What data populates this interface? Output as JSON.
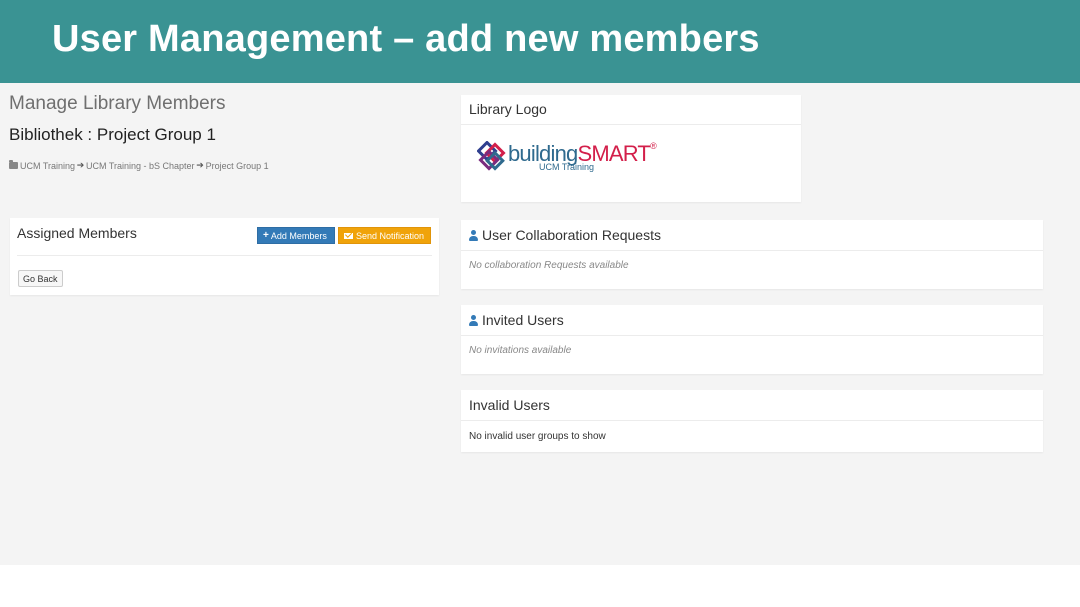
{
  "slide": {
    "title": "User Management – add new members",
    "banner_color": "#3a9393"
  },
  "page": {
    "title": "Manage Library Members",
    "subtitle": "Bibliothek : Project Group 1"
  },
  "breadcrumb": {
    "icon": "folder-icon",
    "items": [
      "UCM Training",
      "UCM Training - bS Chapter",
      "Project Group 1"
    ]
  },
  "assigned_members": {
    "title": "Assigned Members",
    "add_button": "Add Members",
    "add_button_color": "#337ab7",
    "notify_button": "Send Notification",
    "notify_button_color": "#f0a30a",
    "back_button": "Go Back"
  },
  "library_logo": {
    "title": "Library Logo",
    "logo_text_1": "building",
    "logo_text_2": "SMART",
    "logo_mark": "®",
    "logo_tagline": "UCM Training"
  },
  "collab_requests": {
    "title": "User Collaboration Requests",
    "empty_text": "No collaboration Requests available"
  },
  "invited_users": {
    "title": "Invited Users",
    "empty_text": "No invitations available"
  },
  "invalid_users": {
    "title": "Invalid Users",
    "empty_text": "No invalid user groups to show"
  }
}
